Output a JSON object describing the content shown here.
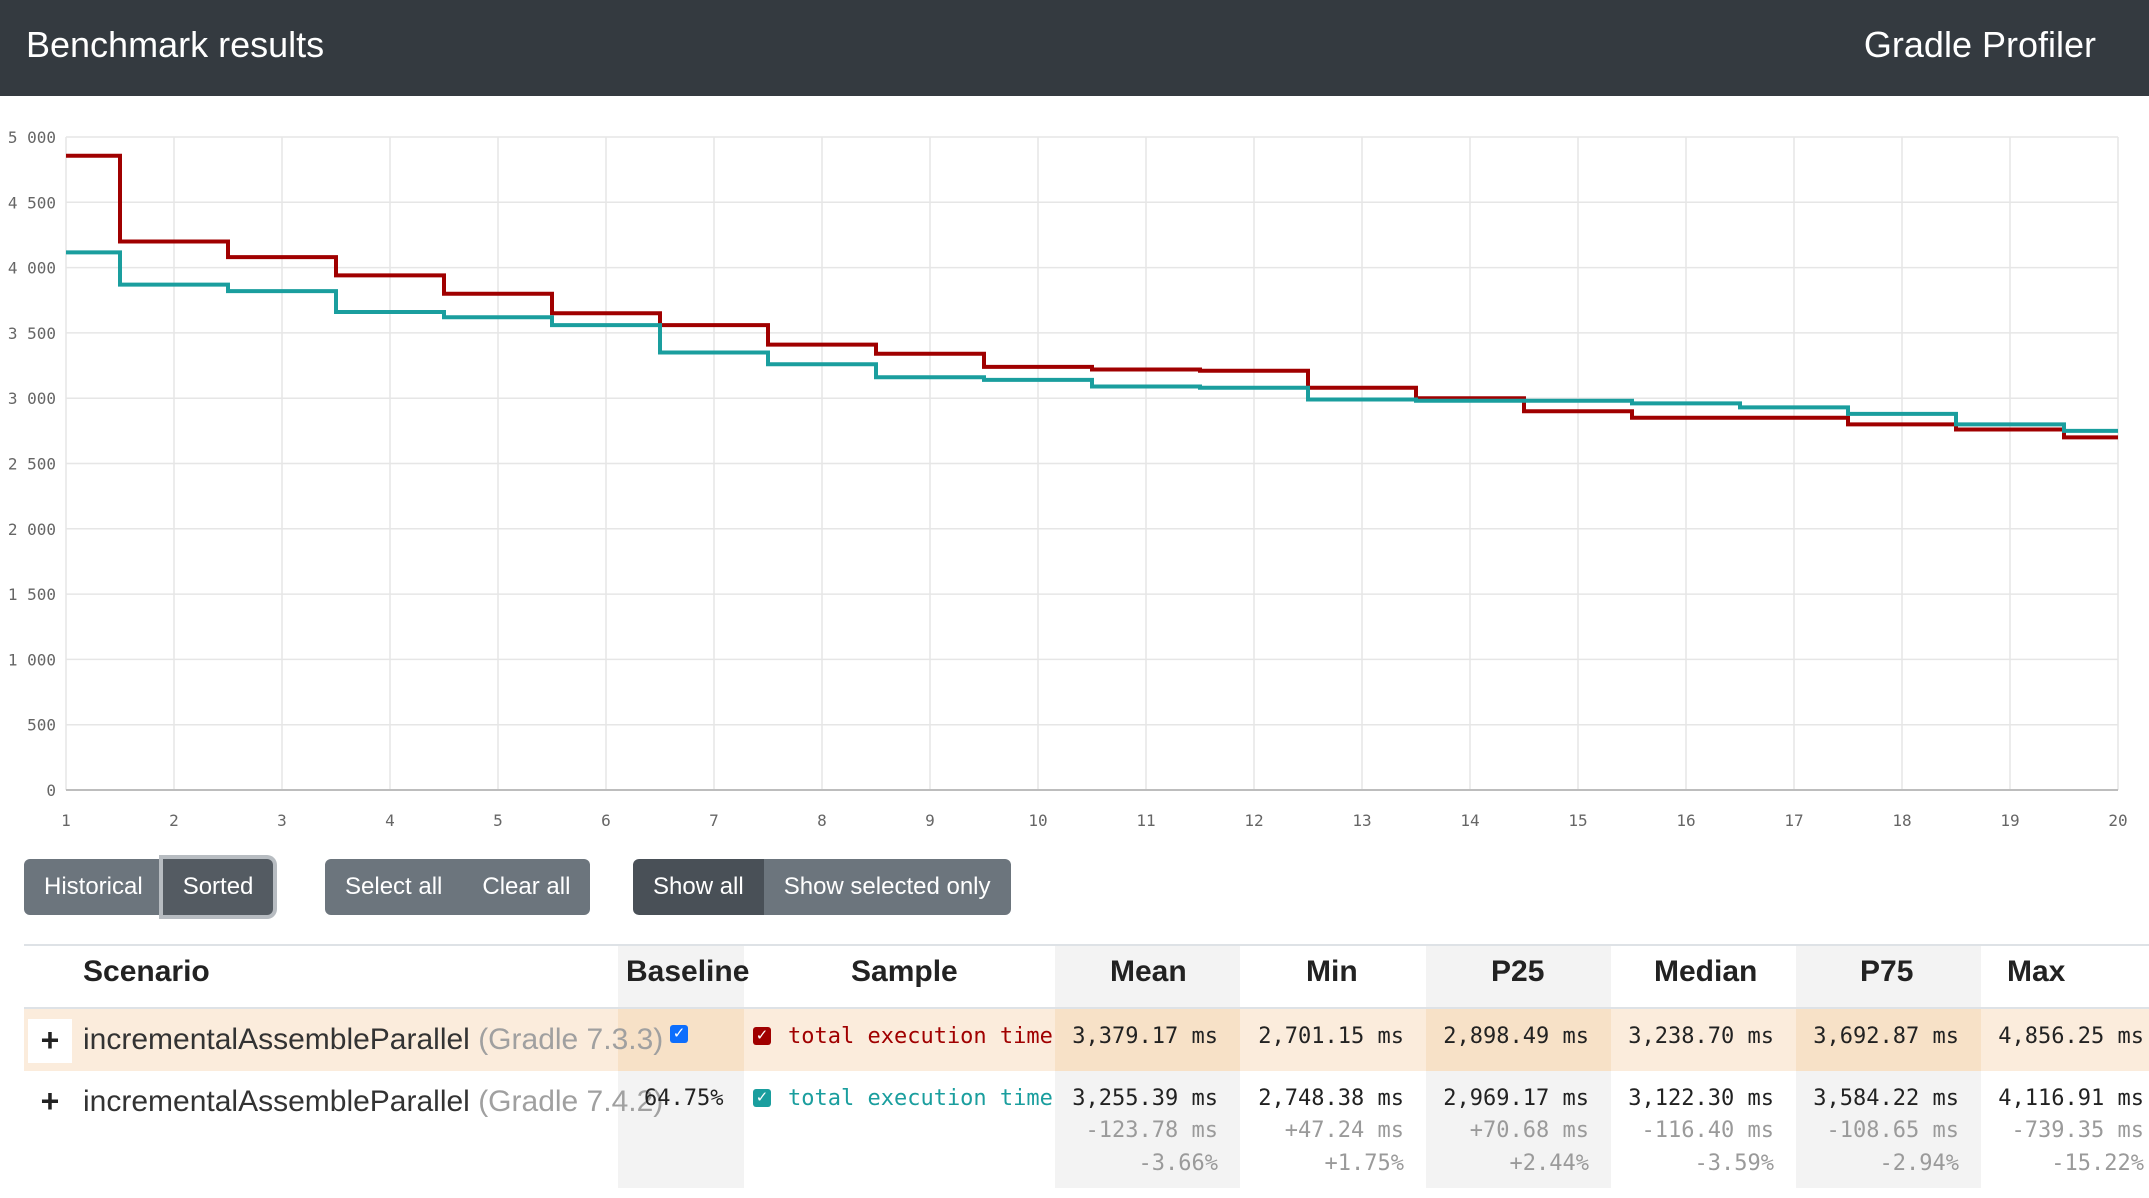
{
  "header": {
    "title": "Benchmark results",
    "brand": "Gradle Profiler"
  },
  "colors": {
    "series_1": "#a00000",
    "series_2": "#1a9e9e",
    "checkbox_baseline": "#0d6efd"
  },
  "controls": {
    "view": {
      "historical": "Historical",
      "sorted": "Sorted",
      "active": "Sorted"
    },
    "selection": {
      "select_all": "Select all",
      "clear_all": "Clear all"
    },
    "filter": {
      "show_all": "Show all",
      "show_selected_only": "Show selected only"
    }
  },
  "table": {
    "headers": {
      "scenario": "Scenario",
      "baseline": "Baseline",
      "sample": "Sample",
      "mean": "Mean",
      "min": "Min",
      "p25": "P25",
      "median": "Median",
      "p75": "P75",
      "max": "Max"
    },
    "rows": [
      {
        "expand": "+",
        "scenario": "incrementalAssembleParallel",
        "version": "(Gradle 7.3.3)",
        "baseline_checked": true,
        "sample": "total execution time",
        "mean": "3,379.17 ms",
        "min": "2,701.15 ms",
        "p25": "2,898.49 ms",
        "median": "3,238.70 ms",
        "p75": "3,692.87 ms",
        "max": "4,856.25 ms"
      },
      {
        "expand": "+",
        "scenario": "incrementalAssembleParallel",
        "version": "(Gradle 7.4.2)",
        "baseline": "64.75%",
        "sample": "total execution time",
        "mean": "3,255.39 ms",
        "min": "2,748.38 ms",
        "p25": "2,969.17 ms",
        "median": "3,122.30 ms",
        "p75": "3,584.22 ms",
        "max": "4,116.91 ms",
        "mean_diff": "-123.78 ms",
        "min_diff": "+47.24 ms",
        "p25_diff": "+70.68 ms",
        "median_diff": "-116.40 ms",
        "p75_diff": "-108.65 ms",
        "max_diff": "-739.35 ms",
        "mean_pct": "-3.66%",
        "min_pct": "+1.75%",
        "p25_pct": "+2.44%",
        "median_pct": "-3.59%",
        "p75_pct": "-2.94%",
        "max_pct": "-15.22%"
      }
    ]
  },
  "chart_data": {
    "type": "line",
    "step": true,
    "x": [
      1,
      2,
      3,
      4,
      5,
      6,
      7,
      8,
      9,
      10,
      11,
      12,
      13,
      14,
      15,
      16,
      17,
      18,
      19,
      20
    ],
    "xlim": [
      1,
      20
    ],
    "ylim": [
      0,
      5000
    ],
    "x_ticks": [
      "1",
      "2",
      "3",
      "4",
      "5",
      "6",
      "7",
      "8",
      "9",
      "10",
      "11",
      "12",
      "13",
      "14",
      "15",
      "16",
      "17",
      "18",
      "19",
      "20"
    ],
    "y_ticks": [
      "0",
      "500",
      "1 000",
      "1 500",
      "2 000",
      "2 500",
      "3 000",
      "3 500",
      "4 000",
      "4 500",
      "5 000"
    ],
    "y_tick_values": [
      0,
      500,
      1000,
      1500,
      2000,
      2500,
      3000,
      3500,
      4000,
      4500,
      5000
    ],
    "grid": true,
    "series": [
      {
        "color": "#a00000",
        "values": [
          4856,
          4200,
          4080,
          3940,
          3800,
          3650,
          3560,
          3410,
          3340,
          3240,
          3220,
          3210,
          3080,
          3000,
          2900,
          2850,
          2850,
          2800,
          2760,
          2700
        ]
      },
      {
        "color": "#1a9e9e",
        "values": [
          4117,
          3870,
          3820,
          3660,
          3620,
          3560,
          3350,
          3260,
          3160,
          3140,
          3090,
          3080,
          2990,
          2980,
          2980,
          2960,
          2930,
          2880,
          2800,
          2750
        ]
      }
    ]
  }
}
